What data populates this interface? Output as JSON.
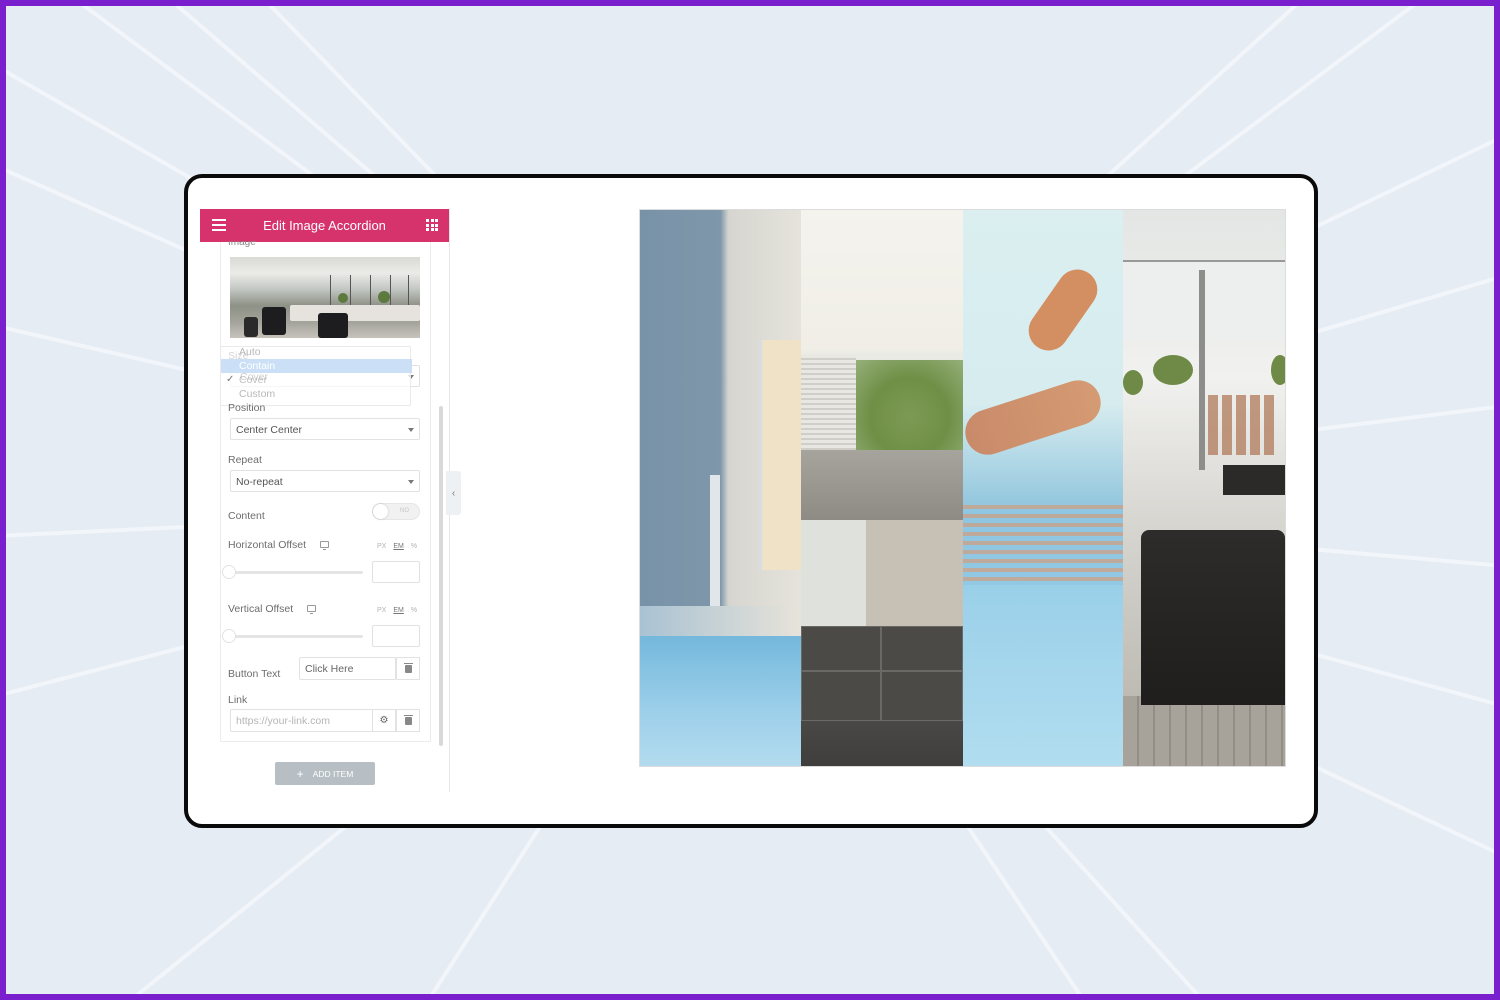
{
  "editor": {
    "title": "Edit Image Accordion",
    "image_label": "Image",
    "size": {
      "label": "Size",
      "value": "Cover",
      "options": [
        "Auto",
        "Contain",
        "Cover",
        "Custom"
      ],
      "highlighted_option": "Contain"
    },
    "position": {
      "label": "Position",
      "value": "Center Center"
    },
    "repeat": {
      "label": "Repeat",
      "value": "No-repeat"
    },
    "content": {
      "label": "Content",
      "toggle_text": "NO",
      "enabled": false
    },
    "horizontal_offset": {
      "label": "Horizontal Offset",
      "units": [
        "PX",
        "EM",
        "%"
      ],
      "active_unit": "EM",
      "value": ""
    },
    "vertical_offset": {
      "label": "Vertical Offset",
      "units": [
        "PX",
        "EM",
        "%"
      ],
      "active_unit": "EM",
      "value": ""
    },
    "button_text": {
      "label": "Button Text",
      "value": "Click Here"
    },
    "link": {
      "label": "Link",
      "placeholder": "https://your-link.com"
    },
    "add_item": {
      "icon": "+",
      "label": "ADD ITEM"
    },
    "collapse_icon": "‹"
  },
  "preview": {
    "panels": [
      {
        "name": "modern-house-pool"
      },
      {
        "name": "living-room-sofa"
      },
      {
        "name": "woman-in-pool"
      },
      {
        "name": "interior-lounge"
      }
    ]
  },
  "colors": {
    "brand": "#d6336c",
    "border": "#7a1fce",
    "background": "#e6ecf4"
  }
}
